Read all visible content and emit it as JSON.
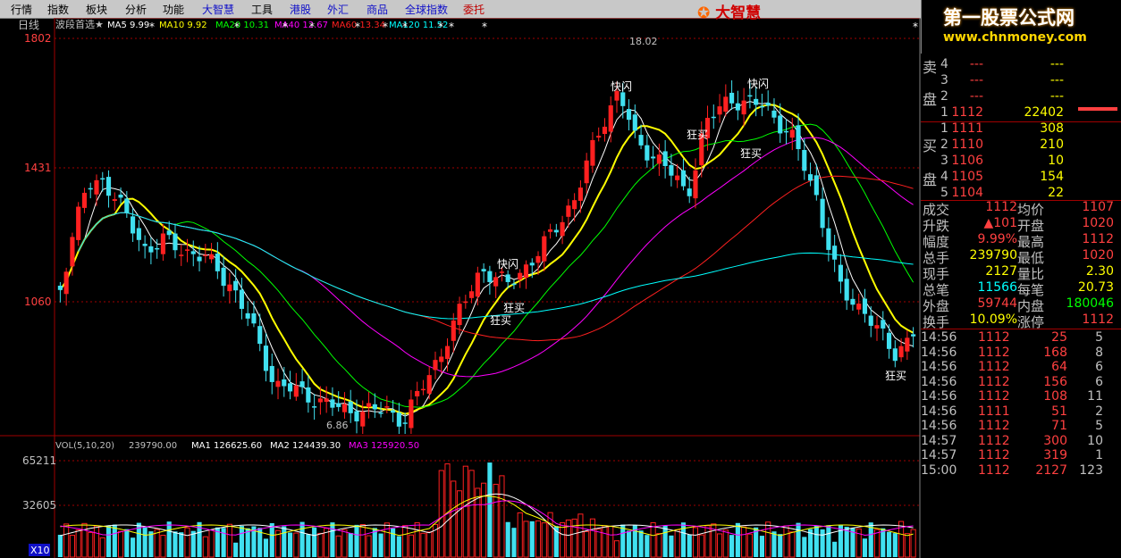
{
  "menu": [
    {
      "label": "行情",
      "style": "normal"
    },
    {
      "label": "指数",
      "style": "normal"
    },
    {
      "label": "板块",
      "style": "normal"
    },
    {
      "label": "分析",
      "style": "normal"
    },
    {
      "label": "功能",
      "style": "normal"
    },
    {
      "label": "大智慧",
      "style": "blue"
    },
    {
      "label": "工具",
      "style": "normal"
    },
    {
      "label": "港股",
      "style": "blue"
    },
    {
      "label": "外汇",
      "style": "blue"
    },
    {
      "label": "商品",
      "style": "blue"
    },
    {
      "label": "全球指数",
      "style": "blue"
    },
    {
      "label": "委托",
      "style": "red"
    }
  ],
  "brand": "大智慧",
  "banner": {
    "title": "第一股票公式网",
    "url": "www.chnmoney.com"
  },
  "chart": {
    "period_label": "日线",
    "indicator_name": "波段首选★",
    "ma_legend": [
      {
        "text": "MA5 9.99",
        "color": "#ffffff"
      },
      {
        "text": "MA10 9.92",
        "color": "#ffff00"
      },
      {
        "text": "MA20 10.31",
        "color": "#00ff00"
      },
      {
        "text": "MA40 12.67",
        "color": "#ff00ff"
      },
      {
        "text": "MA60 13.34",
        "color": "#ff2020"
      },
      {
        "text": "MA120 11.52",
        "color": "#00ffff"
      }
    ],
    "price_axis": [
      "1802",
      "1431",
      "1060"
    ],
    "annotations": {
      "high": "18.02",
      "low": "6.86",
      "signals": [
        {
          "text": "快闪",
          "color": "#ffffff"
        },
        {
          "text": "快闪",
          "color": "#ffffff"
        },
        {
          "text": "快闪",
          "color": "#ffffff"
        },
        {
          "text": "狂买",
          "color": "#ffffff"
        },
        {
          "text": "狂买",
          "color": "#ffffff"
        },
        {
          "text": "狂买",
          "color": "#ffffff"
        },
        {
          "text": "狂买",
          "color": "#ffffff"
        },
        {
          "text": "狂买",
          "color": "#ffffff"
        }
      ]
    },
    "volume_legend": [
      {
        "text": "VOL(5,10,20)",
        "color": "#c0c0c0"
      },
      {
        "text": "239790.00",
        "color": "#c0c0c0"
      },
      {
        "text": "MA1 126625.60",
        "color": "#ffffff"
      },
      {
        "text": "MA2 124439.30",
        "color": "#ffffff"
      },
      {
        "text": "MA3 125920.50",
        "color": "#ff00ff"
      }
    ],
    "volume_axis": [
      "65211",
      "32605"
    ],
    "volume_unit": "X10"
  },
  "order_book": {
    "sell_label": [
      "卖",
      "盘"
    ],
    "buy_label": [
      "买",
      "盘"
    ],
    "sell": [
      {
        "level": "4",
        "price": "---",
        "volume": "---"
      },
      {
        "level": "3",
        "price": "---",
        "volume": "---"
      },
      {
        "level": "2",
        "price": "---",
        "volume": "---"
      },
      {
        "level": "1",
        "price": "1112",
        "volume": "22402"
      }
    ],
    "buy": [
      {
        "level": "1",
        "price": "1111",
        "volume": "308"
      },
      {
        "level": "2",
        "price": "1110",
        "volume": "210"
      },
      {
        "level": "3",
        "price": "1106",
        "volume": "10"
      },
      {
        "level": "4",
        "price": "1105",
        "volume": "154"
      },
      {
        "level": "5",
        "price": "1104",
        "volume": "22"
      }
    ]
  },
  "stats": [
    {
      "l1": "成交",
      "v1": "1112",
      "l2": "均价",
      "v2": "1107",
      "v1color": "#ff4040",
      "v2color": "#ff4040"
    },
    {
      "l1": "升跌",
      "v1": "▲101",
      "l2": "开盘",
      "v2": "1020",
      "v1color": "#ff4040",
      "v2color": "#ff4040"
    },
    {
      "l1": "幅度",
      "v1": "9.99%",
      "l2": "最高",
      "v2": "1112",
      "v1color": "#ff4040",
      "v2color": "#ff4040"
    },
    {
      "l1": "总手",
      "v1": "239790",
      "l2": "最低",
      "v2": "1020",
      "v1color": "#ffff00",
      "v2color": "#ff4040"
    },
    {
      "l1": "现手",
      "v1": "2127",
      "l2": "量比",
      "v2": "2.30",
      "v1color": "#ffff00",
      "v2color": "#ffff00"
    },
    {
      "l1": "总笔",
      "v1": "11566",
      "l2": "每笔",
      "v2": "20.73",
      "v1color": "#00ffff",
      "v2color": "#ffff00"
    },
    {
      "l1": "外盘",
      "v1": "59744",
      "l2": "内盘",
      "v2": "180046",
      "v1color": "#ff4040",
      "v2color": "#00ff00"
    },
    {
      "l1": "换手",
      "v1": "10.09%",
      "l2": "涨停",
      "v2": "1112",
      "v1color": "#ffff00",
      "v2color": "#ff4040"
    }
  ],
  "trades": [
    {
      "time": "14:56",
      "price": "1112",
      "vol": "25",
      "n": "5"
    },
    {
      "time": "14:56",
      "price": "1112",
      "vol": "168",
      "n": "8"
    },
    {
      "time": "14:56",
      "price": "1112",
      "vol": "64",
      "n": "6"
    },
    {
      "time": "14:56",
      "price": "1112",
      "vol": "156",
      "n": "6"
    },
    {
      "time": "14:56",
      "price": "1112",
      "vol": "108",
      "n": "11"
    },
    {
      "time": "14:56",
      "price": "1111",
      "vol": "51",
      "n": "2"
    },
    {
      "time": "14:56",
      "price": "1112",
      "vol": "71",
      "n": "5"
    },
    {
      "time": "14:57",
      "price": "1112",
      "vol": "300",
      "n": "10"
    },
    {
      "time": "14:57",
      "price": "1112",
      "vol": "319",
      "n": "1"
    },
    {
      "time": "15:00",
      "price": "1112",
      "vol": "2127",
      "n": "123"
    }
  ]
}
